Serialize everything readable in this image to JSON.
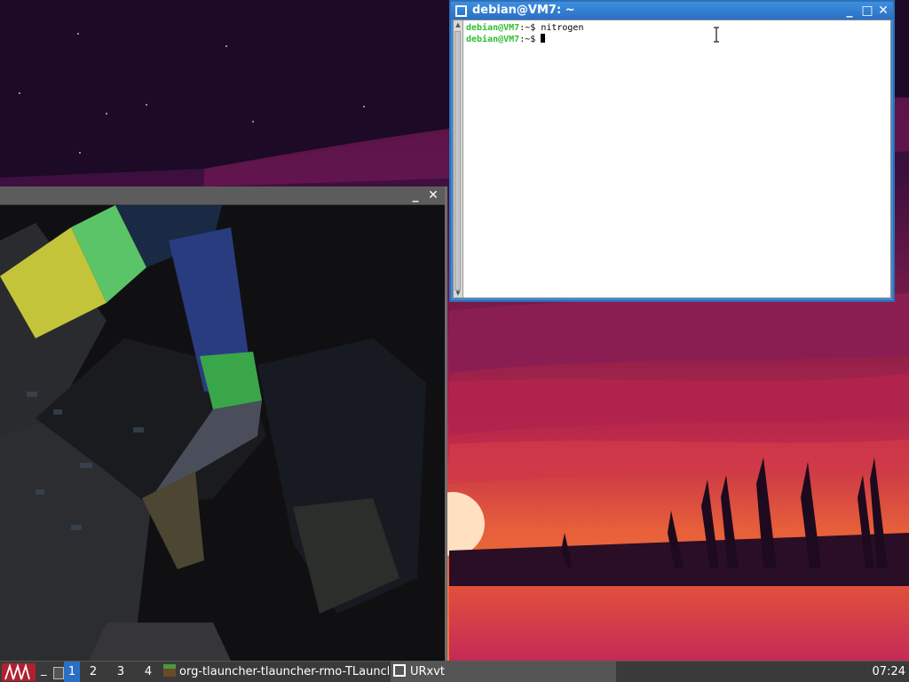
{
  "terminal": {
    "title": "debian@VM7: ~",
    "lines": [
      {
        "user": "debian@VM7",
        "path": ":~$ ",
        "cmd": "nitrogen"
      },
      {
        "user": "debian@VM7",
        "path": ":~$ ",
        "cmd": ""
      }
    ],
    "buttons": {
      "minimize": "_",
      "maximize": "□",
      "close": "✕"
    }
  },
  "launcher_window": {
    "buttons": {
      "minimize": "_",
      "close": "✕"
    }
  },
  "taskbar": {
    "workspaces": [
      "1",
      "2",
      "3",
      "4"
    ],
    "tasks": [
      {
        "label": "org-tlauncher-tlauncher-rmo-TLauncher",
        "icon": "grass-block-icon"
      },
      {
        "label": "URxvt",
        "icon": "window-icon"
      }
    ],
    "clock": "07:24",
    "menu_icon": "app-menu-icon"
  },
  "colors": {
    "titlebar_active": "#3c8ad6",
    "prompt_user": "#2fbf2f",
    "taskbar_bg": "#3a3a3a"
  }
}
